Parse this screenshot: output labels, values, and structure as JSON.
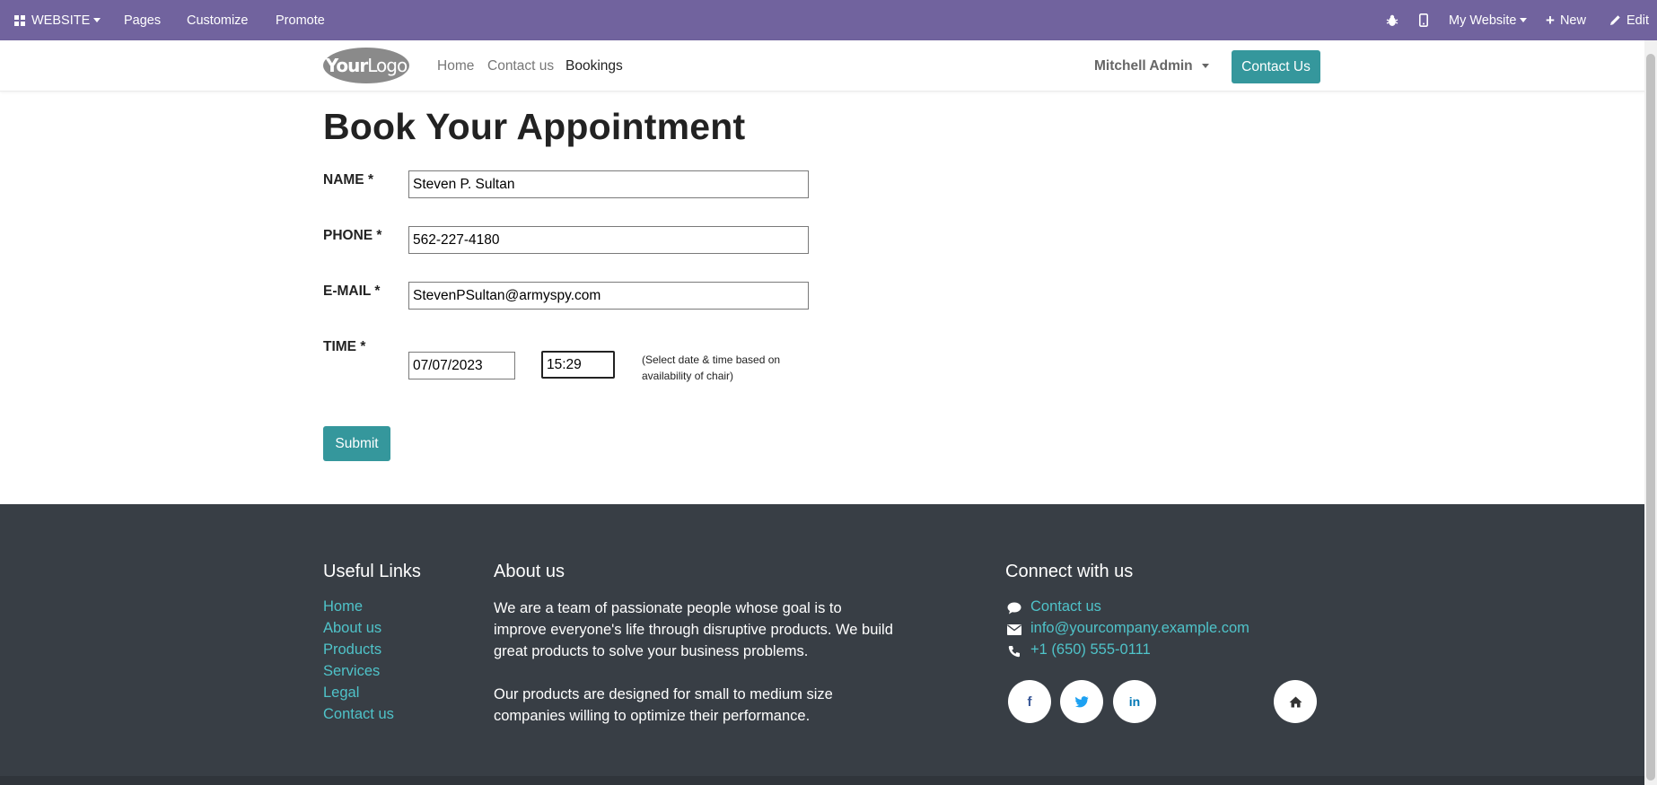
{
  "adminbar": {
    "website_menu": "WEBSITE",
    "pages": "Pages",
    "customize": "Customize",
    "promote": "Promote",
    "my_website": "My Website",
    "new": "New",
    "edit": "Edit"
  },
  "header": {
    "logo_bold": "Your",
    "logo_light": "Logo",
    "nav": [
      "Home",
      "Contact us",
      "Bookings"
    ],
    "active_nav": "Bookings",
    "user": "Mitchell Admin",
    "contact_button": "Contact Us"
  },
  "form": {
    "title": "Book Your Appointment",
    "name_label": "NAME *",
    "name_value": "Steven P. Sultan",
    "phone_label": "PHONE *",
    "phone_value": "562-227-4180",
    "email_label": "E-MAIL *",
    "email_value": "StevenPSultan@armyspy.com",
    "time_label": "TIME *",
    "date_value": "07/07/2023",
    "time_value": "15:29",
    "hint": "(Select date & time based on availability of chair)",
    "submit": "Submit"
  },
  "footer": {
    "useful_links_title": "Useful Links",
    "useful_links": [
      "Home",
      "About us",
      "Products",
      "Services",
      "Legal",
      "Contact us"
    ],
    "about_title": "About us",
    "about_p1": "We are a team of passionate people whose goal is to improve everyone's life through disruptive products. We build great products to solve your business problems.",
    "about_p2": "Our products are designed for small to medium size companies willing to optimize their performance.",
    "connect_title": "Connect with us",
    "connect_contact": "Contact us",
    "connect_email": "info@yourcompany.example.com",
    "connect_phone": "+1 (650) 555-0111"
  },
  "colors": {
    "admin_bar": "#71639e",
    "primary": "#35979c",
    "footer_bg": "#383e45",
    "footer_link": "#4fc3c9"
  }
}
